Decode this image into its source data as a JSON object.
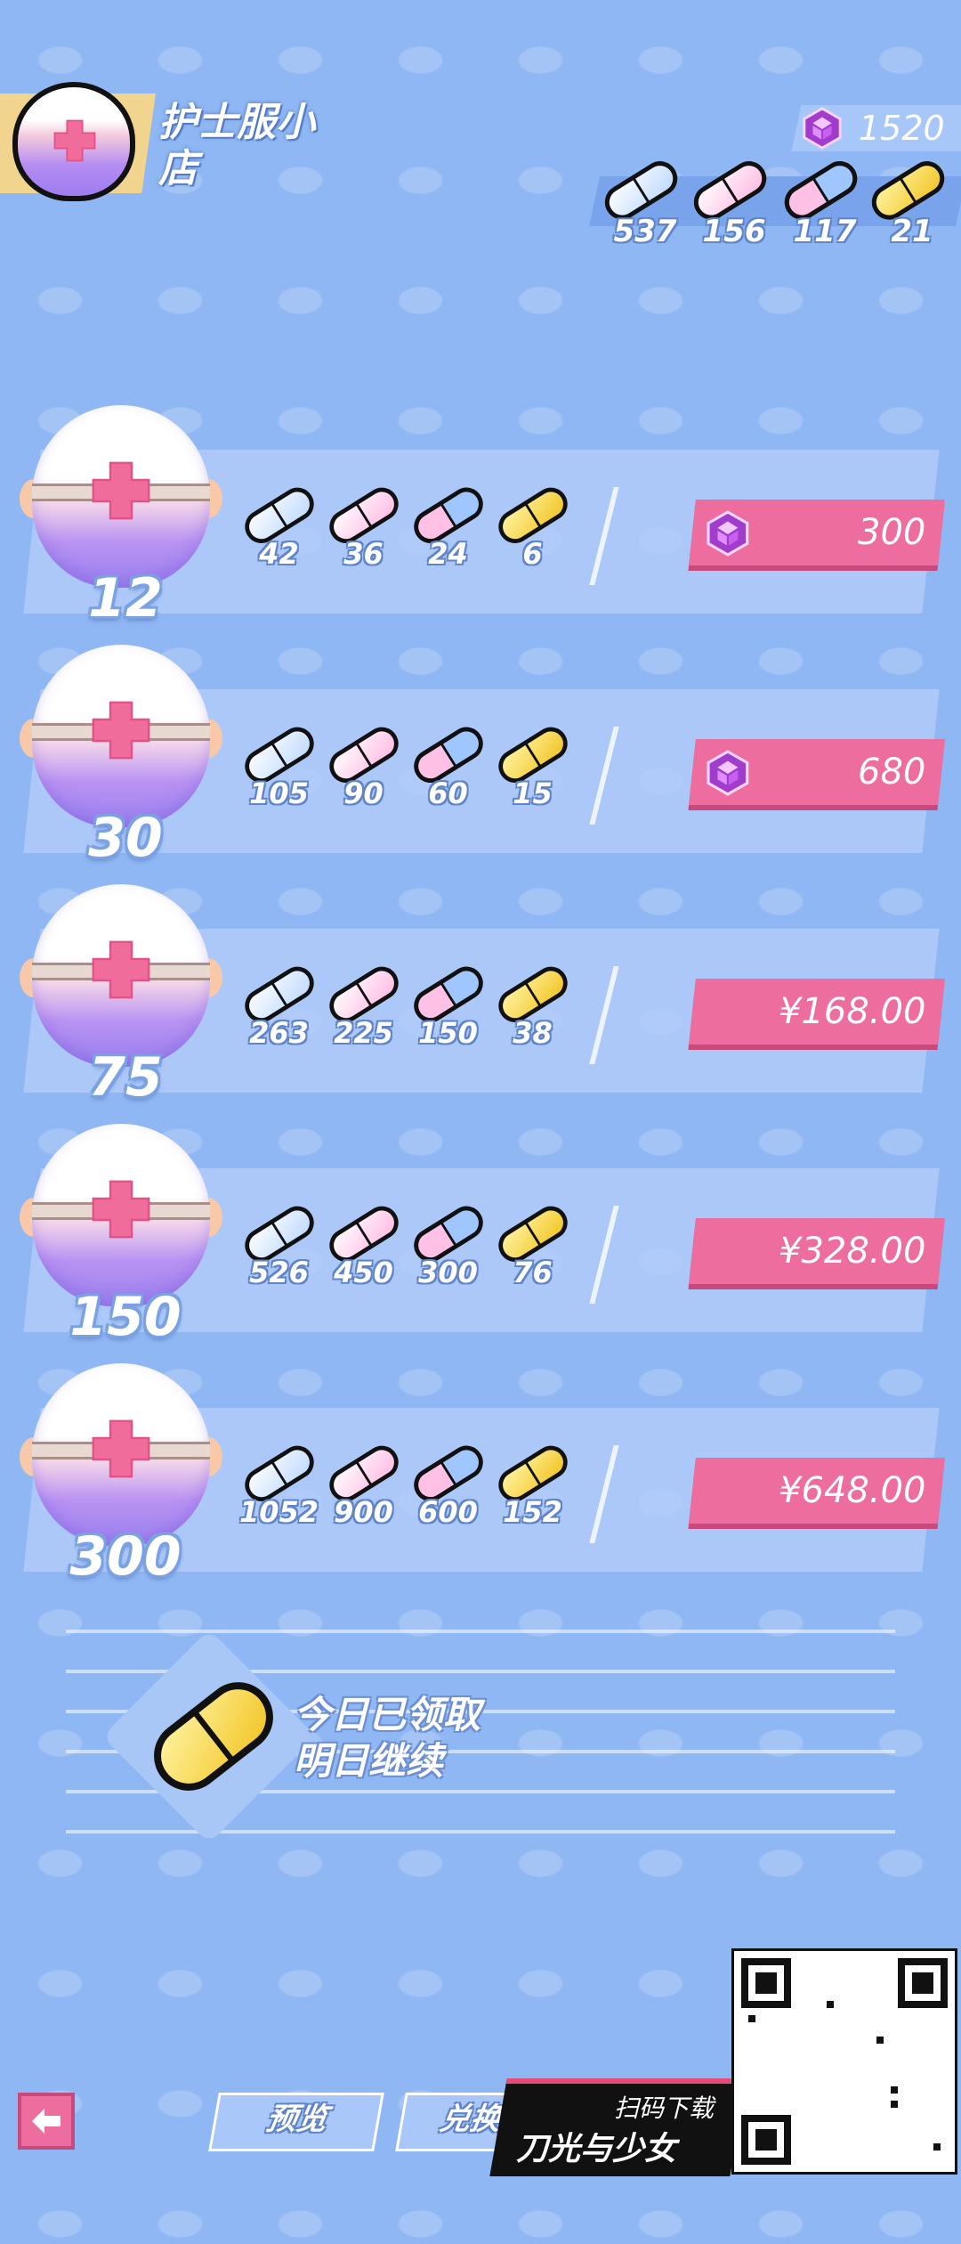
{
  "shop": {
    "title": "护士服小店"
  },
  "currency": {
    "gems": "1520",
    "pills": [
      {
        "icon": "blue-pill-icon",
        "count": "537",
        "color": "#bcd8ff"
      },
      {
        "icon": "pink-pill-icon",
        "count": "156",
        "color": "#ffc3e6"
      },
      {
        "icon": "pink-blue-pill-icon",
        "count": "117",
        "color": "#9fc7ff"
      },
      {
        "icon": "gold-pill-icon",
        "count": "21",
        "color": "#f5d84a"
      }
    ]
  },
  "packs": [
    {
      "qty": "12",
      "pills": [
        "42",
        "36",
        "24",
        "6"
      ],
      "price": "300",
      "price_type": "gem"
    },
    {
      "qty": "30",
      "pills": [
        "105",
        "90",
        "60",
        "15"
      ],
      "price": "680",
      "price_type": "gem"
    },
    {
      "qty": "75",
      "pills": [
        "263",
        "225",
        "150",
        "38"
      ],
      "price": "¥168.00",
      "price_type": "cash"
    },
    {
      "qty": "150",
      "pills": [
        "526",
        "450",
        "300",
        "76"
      ],
      "price": "¥328.00",
      "price_type": "cash"
    },
    {
      "qty": "300",
      "pills": [
        "1052",
        "900",
        "600",
        "152"
      ],
      "price": "¥648.00",
      "price_type": "cash"
    }
  ],
  "daily": {
    "line1": "今日已领取",
    "line2": "明日继续"
  },
  "bottom": {
    "preview": "预览",
    "exchange": "兑换",
    "promo_sub": "扫码下载",
    "promo_title": "刀光与少女"
  },
  "colors": {
    "accent_pink": "#ee6d9f",
    "background": "#8fb7f3",
    "gem": "#b03fd6"
  }
}
